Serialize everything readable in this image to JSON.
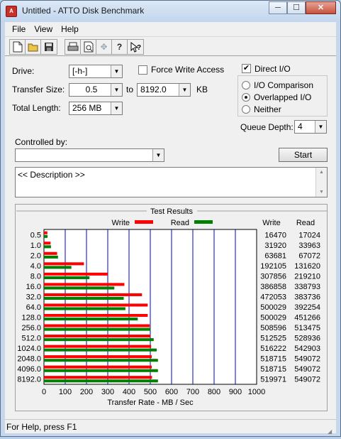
{
  "window": {
    "title": "Untitled - ATTO Disk Benchmark",
    "minimize": "─",
    "maximize": "☐",
    "close": "✕"
  },
  "menu": [
    "File",
    "View",
    "Help"
  ],
  "toolbar": [
    "new-icon",
    "open-icon",
    "save-icon",
    "print-icon",
    "print-preview-icon",
    "move-icon",
    "help-icon",
    "context-help-icon"
  ],
  "settings": {
    "drive_label": "Drive:",
    "drive_value": "[-h-]",
    "force_write_label": "Force Write Access",
    "force_write_checked": false,
    "direct_io_label": "Direct I/O",
    "direct_io_checked": true,
    "transfer_size_label": "Transfer Size:",
    "transfer_from": "0.5",
    "to_label": "to",
    "transfer_to": "8192.0",
    "kb_label": "KB",
    "total_length_label": "Total Length:",
    "total_length_value": "256 MB",
    "io_comparison_label": "I/O Comparison",
    "overlapped_io_label": "Overlapped I/O",
    "neither_label": "Neither",
    "selected_mode": "Overlapped I/O",
    "queue_depth_label": "Queue Depth:",
    "queue_depth_value": "4",
    "controlled_by_label": "Controlled by:",
    "controlled_by_value": "",
    "start_button": "Start",
    "description": "<< Description >>"
  },
  "results": {
    "title": "Test Results",
    "write_label": "Write",
    "read_label": "Read",
    "write_col": "Write",
    "read_col": "Read",
    "write_color": "#ff0000",
    "read_color": "#008000"
  },
  "chart_data": {
    "type": "bar",
    "orientation": "horizontal",
    "xlabel": "Transfer Rate - MB / Sec",
    "xlim": [
      0,
      1000
    ],
    "xticks": [
      0,
      100,
      200,
      300,
      400,
      500,
      600,
      700,
      800,
      900,
      1000
    ],
    "categories": [
      "0.5",
      "1.0",
      "2.0",
      "4.0",
      "8.0",
      "16.0",
      "32.0",
      "64.0",
      "128.0",
      "256.0",
      "512.0",
      "1024.0",
      "2048.0",
      "4096.0",
      "8192.0"
    ],
    "series": [
      {
        "name": "Write",
        "values": [
          16,
          31,
          62,
          188,
          300,
          378,
          461,
          488,
          488,
          497,
          501,
          504,
          507,
          507,
          508
        ]
      },
      {
        "name": "Read",
        "values": [
          17,
          33,
          66,
          129,
          214,
          331,
          375,
          383,
          441,
          501,
          516,
          530,
          536,
          536,
          536
        ]
      }
    ],
    "write_values_text": [
      "16470",
      "31920",
      "63681",
      "192105",
      "307856",
      "386858",
      "472053",
      "500029",
      "500029",
      "508596",
      "512525",
      "516222",
      "518715",
      "518715",
      "519971"
    ],
    "read_values_text": [
      "17024",
      "33963",
      "67072",
      "131620",
      "219210",
      "338793",
      "383736",
      "392254",
      "451266",
      "513475",
      "528936",
      "542903",
      "549072",
      "549072",
      "549072"
    ]
  },
  "status": {
    "text": "For Help, press F1"
  }
}
